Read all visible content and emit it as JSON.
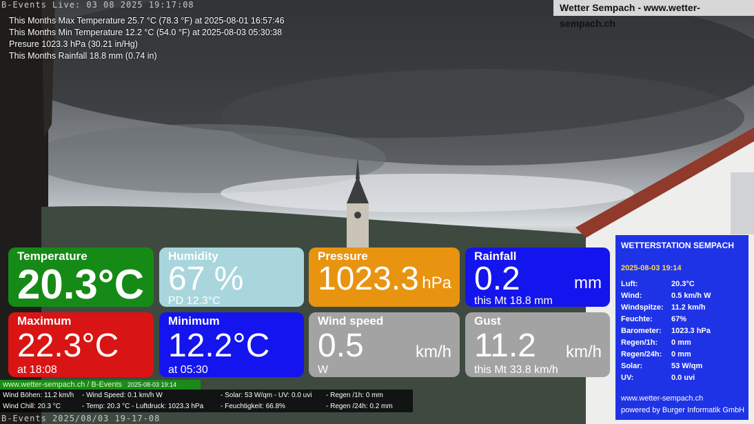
{
  "camera": {
    "overlay_top": "B-Events Live: 03 08 2025 19:17:08",
    "overlay_bottom": "B-Events  2025/08/03 19-17-08"
  },
  "site_title": "Wetter Sempach - www.wetter-sempach.ch",
  "month_stats": [
    "This Months Max Temperature 25.7 °C (78.3 °F) at 2025-08-01 16:57:46",
    "This Months Min Temperature 12.2 °C (54.0 °F) at 2025-08-03 05:30:38",
    "Presure 1023.3 hPa (30.21 in/Hg)",
    "This Months Rainfall 18.8 mm (0.74 in)"
  ],
  "tiles": {
    "temperature": {
      "title": "Temperature",
      "value": "20.3°C",
      "color": "#168a16"
    },
    "humidity": {
      "title": "Humidity",
      "value": "67 %",
      "sub": "PD 12.3°C",
      "color": "#a9d6dc"
    },
    "pressure": {
      "title": "Pressure",
      "value": "1023.3",
      "unit": "hPa",
      "color": "#e89410"
    },
    "rainfall": {
      "title": "Rainfall",
      "value": "0.2",
      "unit": "mm",
      "sub": "this Mt 18.8 mm",
      "color": "#1414ee"
    },
    "maximum": {
      "title": "Maximum",
      "value": "22.3°C",
      "sub": "at 18:08",
      "color": "#d81414"
    },
    "minimum": {
      "title": "Minimum",
      "value": "12.2°C",
      "sub": "at 05:30",
      "color": "#1414ee"
    },
    "wind_speed": {
      "title": "Wind speed",
      "value": "0.5",
      "unit": "km/h",
      "sub": "W",
      "color": "#a3a3a3"
    },
    "gust": {
      "title": "Gust",
      "value": "11.2",
      "unit": "km/h",
      "sub": "this Mt 33.8 km/h",
      "color": "#a3a3a3"
    }
  },
  "station": {
    "title": "WETTERSTATION SEMPACH",
    "datetime": "2025-08-03 19:14",
    "rows": [
      {
        "label": "Luft:",
        "value": "20.3°C"
      },
      {
        "label": "Wind:",
        "value": "0.5 km/h  W"
      },
      {
        "label": "Windspitze:",
        "value": "11.2 km/h"
      },
      {
        "label": "Feuchte:",
        "value": "67%"
      },
      {
        "label": "Barometer:",
        "value": "1023.3 hPa"
      },
      {
        "label": "Regen/1h:",
        "value": "0 mm"
      },
      {
        "label": "Regen/24h:",
        "value": "0 mm"
      },
      {
        "label": "Solar:",
        "value": "53 W/qm"
      },
      {
        "label": "UV:",
        "value": "0.0 uvi"
      }
    ],
    "footer_site": "www.wetter-sempach.ch",
    "footer_powered": "powered by Burger Informatik GmbH"
  },
  "green_bar": {
    "text": "www.wetter-sempach.ch / B-Events",
    "datetime": "2025-08-03 19:14"
  },
  "ticker": {
    "wind_gust": "Wind Böhen: 11.2 km/h",
    "wind_speed": "- Wind Speed: 0.1 km/h W",
    "solar_uv": "- Solar: 53 W/qm   - UV: 0.0 uvi",
    "rain_1h": "- Regen /1h:   0 mm",
    "wind_chill": "Wind Chill: 20.3 °C",
    "temp_pressure": "- Temp: 20.3 °C  - Luftdruck: 1023.3 hPa",
    "humidity": "- Feuchtigkeit: 66.8%",
    "rain_24h": "- Regen /24h: 0.2 mm"
  }
}
